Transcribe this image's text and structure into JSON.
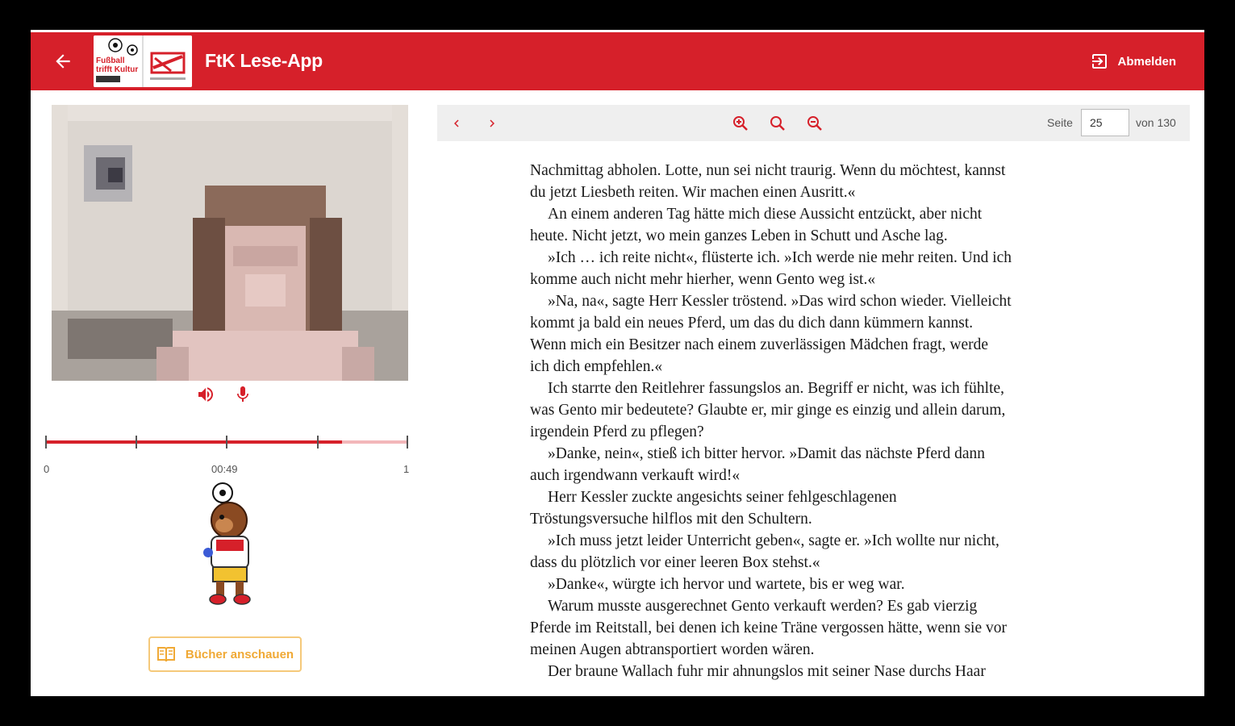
{
  "appbar": {
    "title": "FtK Lese-App",
    "logout_label": "Abmelden",
    "logo_text": "Fußball trifft Kultur"
  },
  "player": {
    "timeline": {
      "start_label": "0",
      "current_label": "00:49",
      "end_label": "1",
      "progress": 0.82
    }
  },
  "books_button": {
    "label": "Bücher anschauen"
  },
  "viewer": {
    "page_label": "Seite",
    "page_value": "25",
    "page_total": "von 130"
  },
  "page_text": [
    "Nachmittag abholen. Lotte, nun sei nicht traurig. Wenn du möchtest, kannst",
    "du jetzt Liesbeth reiten. Wir machen einen Ausritt.«",
    "An einem anderen Tag hätte mich diese Aussicht entzückt, aber nicht",
    "heute. Nicht jetzt, wo mein ganzes Leben in Schutt und Asche lag.",
    "»Ich … ich reite nicht«, flüsterte ich. »Ich werde nie mehr reiten. Und ich",
    "komme auch nicht mehr hierher, wenn Gento weg ist.«",
    "»Na, na«, sagte Herr Kessler tröstend. »Das wird schon wieder. Vielleicht",
    "kommt ja bald ein neues Pferd, um das du dich dann kümmern kannst.",
    "Wenn mich ein Besitzer nach einem zuverlässigen Mädchen fragt, werde",
    "ich dich empfehlen.«",
    "Ich starrte den Reitlehrer fassungslos an. Begriff er nicht, was ich fühlte,",
    "was Gento mir bedeutete? Glaubte er, mir ginge es einzig und allein darum,",
    "irgendein Pferd zu pflegen?",
    "»Danke, nein«, stieß ich bitter hervor. »Damit das nächste Pferd dann",
    "auch irgendwann verkauft wird!«",
    "Herr Kessler zuckte angesichts seiner fehlgeschlagenen",
    "Tröstungsversuche hilflos mit den Schultern.",
    "»Ich muss jetzt leider Unterricht geben«, sagte er. »Ich wollte nur nicht,",
    "dass du plötzlich vor einer leeren Box stehst.«",
    "»Danke«, würgte ich hervor und wartete, bis er weg war.",
    "Warum musste ausgerechnet Gento verkauft werden? Es gab vierzig",
    "Pferde im Reitstall, bei denen ich keine Träne vergossen hätte, wenn sie vor",
    "meinen Augen abtransportiert worden wären.",
    "Der braune Wallach fuhr mir ahnungslos mit seiner Nase durchs Haar"
  ],
  "indented_lines": [
    2,
    4,
    6,
    10,
    13,
    15,
    17,
    19,
    20,
    23
  ],
  "colors": {
    "brand_red": "#d6202a",
    "accent_orange": "#f0a935",
    "toolbar_bg": "#efefef"
  }
}
